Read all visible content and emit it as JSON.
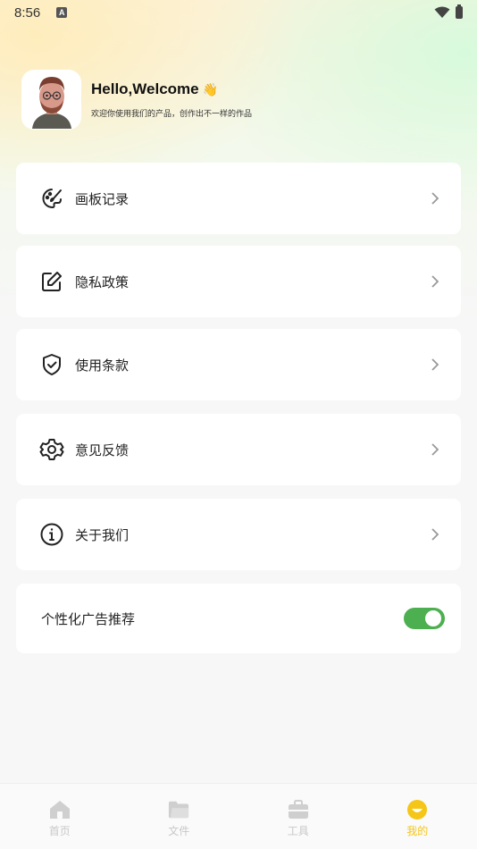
{
  "status_bar": {
    "time": "8:56",
    "notif_letter": "A"
  },
  "profile": {
    "greeting": "Hello,Welcome",
    "wave_emoji": "👋",
    "subtitle": "欢迎你使用我们的产品，创作出不一样的作品"
  },
  "menu": [
    {
      "label": "画板记录",
      "icon": "palette-icon"
    },
    {
      "label": "隐私政策",
      "icon": "edit-icon"
    },
    {
      "label": "使用条款",
      "icon": "shield-check-icon"
    },
    {
      "label": "意见反馈",
      "icon": "gear-icon"
    },
    {
      "label": "关于我们",
      "icon": "info-icon"
    }
  ],
  "ad_setting": {
    "label": "个性化广告推荐",
    "enabled": true
  },
  "bottom_nav": [
    {
      "label": "首页",
      "icon": "home-icon",
      "active": false
    },
    {
      "label": "文件",
      "icon": "folder-icon",
      "active": false
    },
    {
      "label": "工具",
      "icon": "toolbox-icon",
      "active": false
    },
    {
      "label": "我的",
      "icon": "smiley-icon",
      "active": true
    }
  ],
  "colors": {
    "accent_active": "#f5c518",
    "toggle_on": "#4caf50",
    "nav_inactive": "#c8c8c8"
  }
}
